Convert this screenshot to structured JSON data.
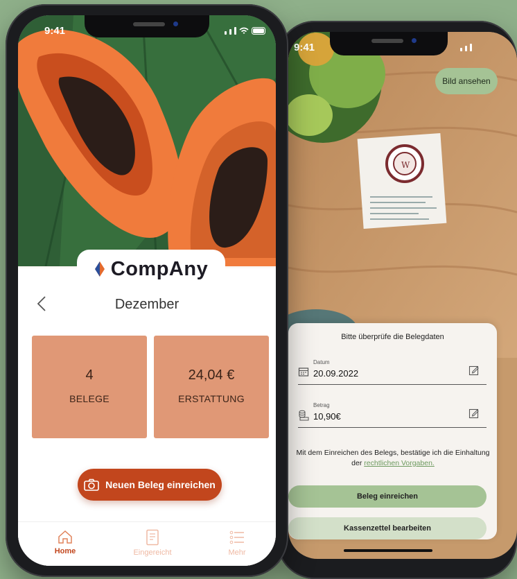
{
  "left_phone": {
    "status_time": "9:41",
    "brand": "CompAny",
    "header": {
      "back_icon": "chevron-left-icon",
      "title": "Dezember"
    },
    "cards": [
      {
        "value": "4",
        "label": "BELEGE"
      },
      {
        "value": "24,04 €",
        "label": "ERSTATTUNG"
      }
    ],
    "cta_label": "Neuen Beleg einreichen",
    "tabs": [
      {
        "label": "Home",
        "icon": "home-icon",
        "active": true
      },
      {
        "label": "Eingereicht",
        "icon": "document-icon",
        "active": false
      },
      {
        "label": "Mehr",
        "icon": "list-icon",
        "active": false
      }
    ]
  },
  "right_phone": {
    "status_time": "9:41",
    "view_image_label": "Bild ansehen",
    "sheet_title": "Bitte überprüfe die Belegdaten",
    "fields": [
      {
        "label": "Datum",
        "value": "20.09.2022",
        "icon": "calendar-icon"
      },
      {
        "label": "Betrag",
        "value": "10,90€",
        "icon": "coins-icon"
      }
    ],
    "consent_text": "Mit dem Einreichen des Belegs, bestätige ich die Einhaltung der",
    "consent_link": "rechtlichen Vorgaben.",
    "submit_label": "Beleg einreichen",
    "edit_label": "Kassenzettel bearbeiten"
  },
  "colors": {
    "background": "#8fb08a",
    "accent": "#c2461d",
    "card": "#e09876",
    "primary_green": "#a5c395",
    "secondary_green": "#d3e0c9"
  }
}
